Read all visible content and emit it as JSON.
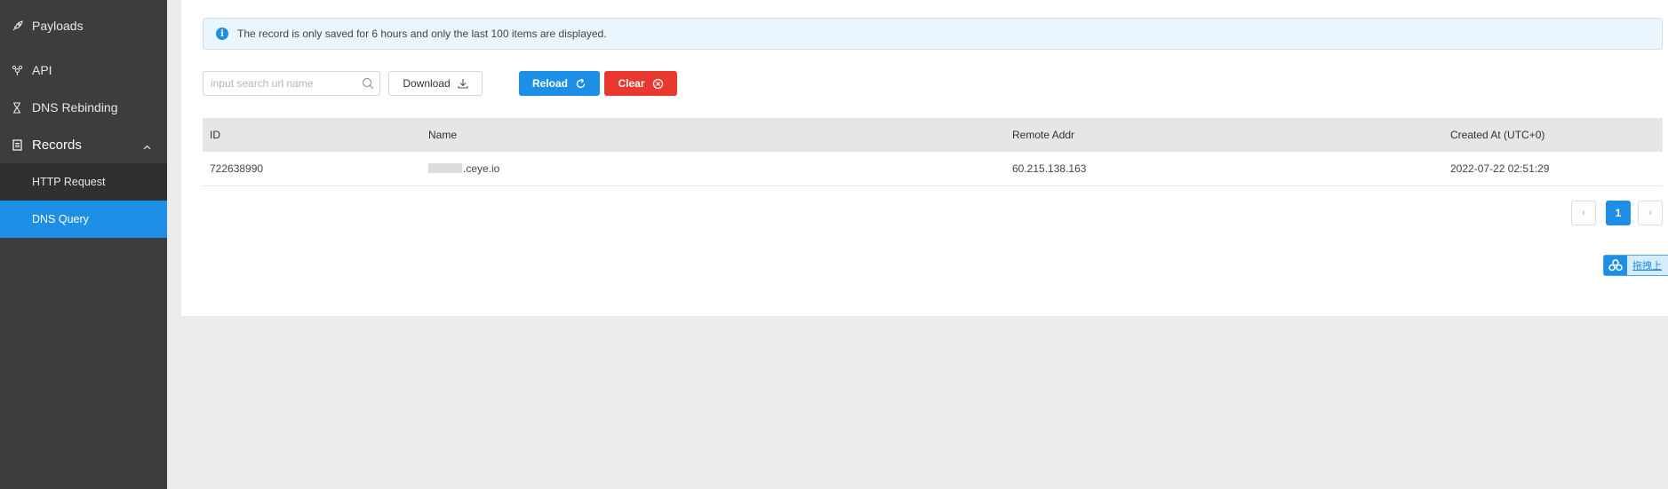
{
  "sidebar": {
    "items": [
      {
        "label": "Payloads",
        "icon": "rocket-icon"
      },
      {
        "label": "API",
        "icon": "api-icon"
      },
      {
        "label": "DNS Rebinding",
        "icon": "hourglass-icon"
      },
      {
        "label": "Records",
        "icon": "records-icon"
      }
    ],
    "records_sub": [
      {
        "label": "HTTP Request"
      },
      {
        "label": "DNS Query",
        "active": true
      }
    ]
  },
  "alert": {
    "text": "The record is only saved for 6 hours and only the last 100 items are displayed."
  },
  "toolbar": {
    "search_placeholder": "input search url name",
    "search_value": "",
    "download_label": "Download",
    "reload_label": "Reload",
    "clear_label": "Clear"
  },
  "table": {
    "headers": [
      "ID",
      "Name",
      "Remote Addr",
      "Created At (UTC+0)"
    ],
    "rows": [
      {
        "id": "722638990",
        "name": ".ceye.io",
        "remote_addr": "60.215.138.163",
        "created_at": "2022-07-22 02:51:29"
      }
    ]
  },
  "pagination": {
    "prev": "‹",
    "current": "1",
    "next": "›"
  },
  "widget": {
    "label": "拖拽上"
  },
  "colors": {
    "sidebar_bg": "#3d3d3d",
    "accent": "#1e8fe6",
    "danger": "#e8382f",
    "alert_bg": "#eaf5fd"
  }
}
